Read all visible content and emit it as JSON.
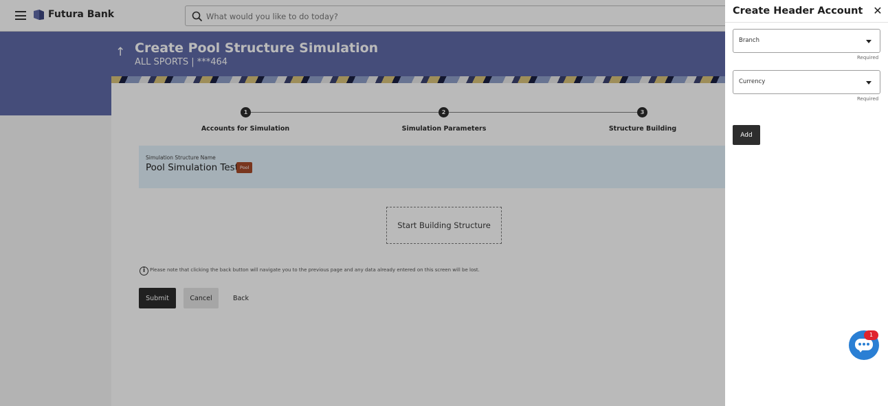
{
  "header": {
    "brand": "Futura Bank",
    "search_placeholder": "What would you like to do today?"
  },
  "page": {
    "title": "Create Pool Structure Simulation",
    "subtitle": "ALL SPORTS | ***464"
  },
  "stepper": {
    "steps": [
      {
        "number": "1",
        "label": "Accounts for Simulation"
      },
      {
        "number": "2",
        "label": "Simulation Parameters"
      },
      {
        "number": "3",
        "label": "Structure Building"
      }
    ]
  },
  "simulation": {
    "caption": "Simulation Structure Name",
    "name": "Pool Simulation Test1",
    "badge": "Pool"
  },
  "start_button_label": "Start Building Structure",
  "info_note": "Please note that clicking the back button will navigate you to the previous page and any data already entered on this screen will be lost.",
  "actions": {
    "submit": "Submit",
    "cancel": "Cancel",
    "back": "Back"
  },
  "drawer": {
    "title": "Create Header Account",
    "close_glyph": "✕",
    "branch_label": "Branch",
    "currency_label": "Currency",
    "required_text": "Required",
    "add_label": "Add"
  },
  "chat": {
    "badge_count": "1"
  },
  "colors": {
    "hero": "#5f6aa8",
    "dark_button": "#2d2d2d",
    "simulation_box": "#e3f1fb",
    "pool_badge": "#a74a2a",
    "chat": "#2a7fd4",
    "notification": "#e0242e"
  }
}
